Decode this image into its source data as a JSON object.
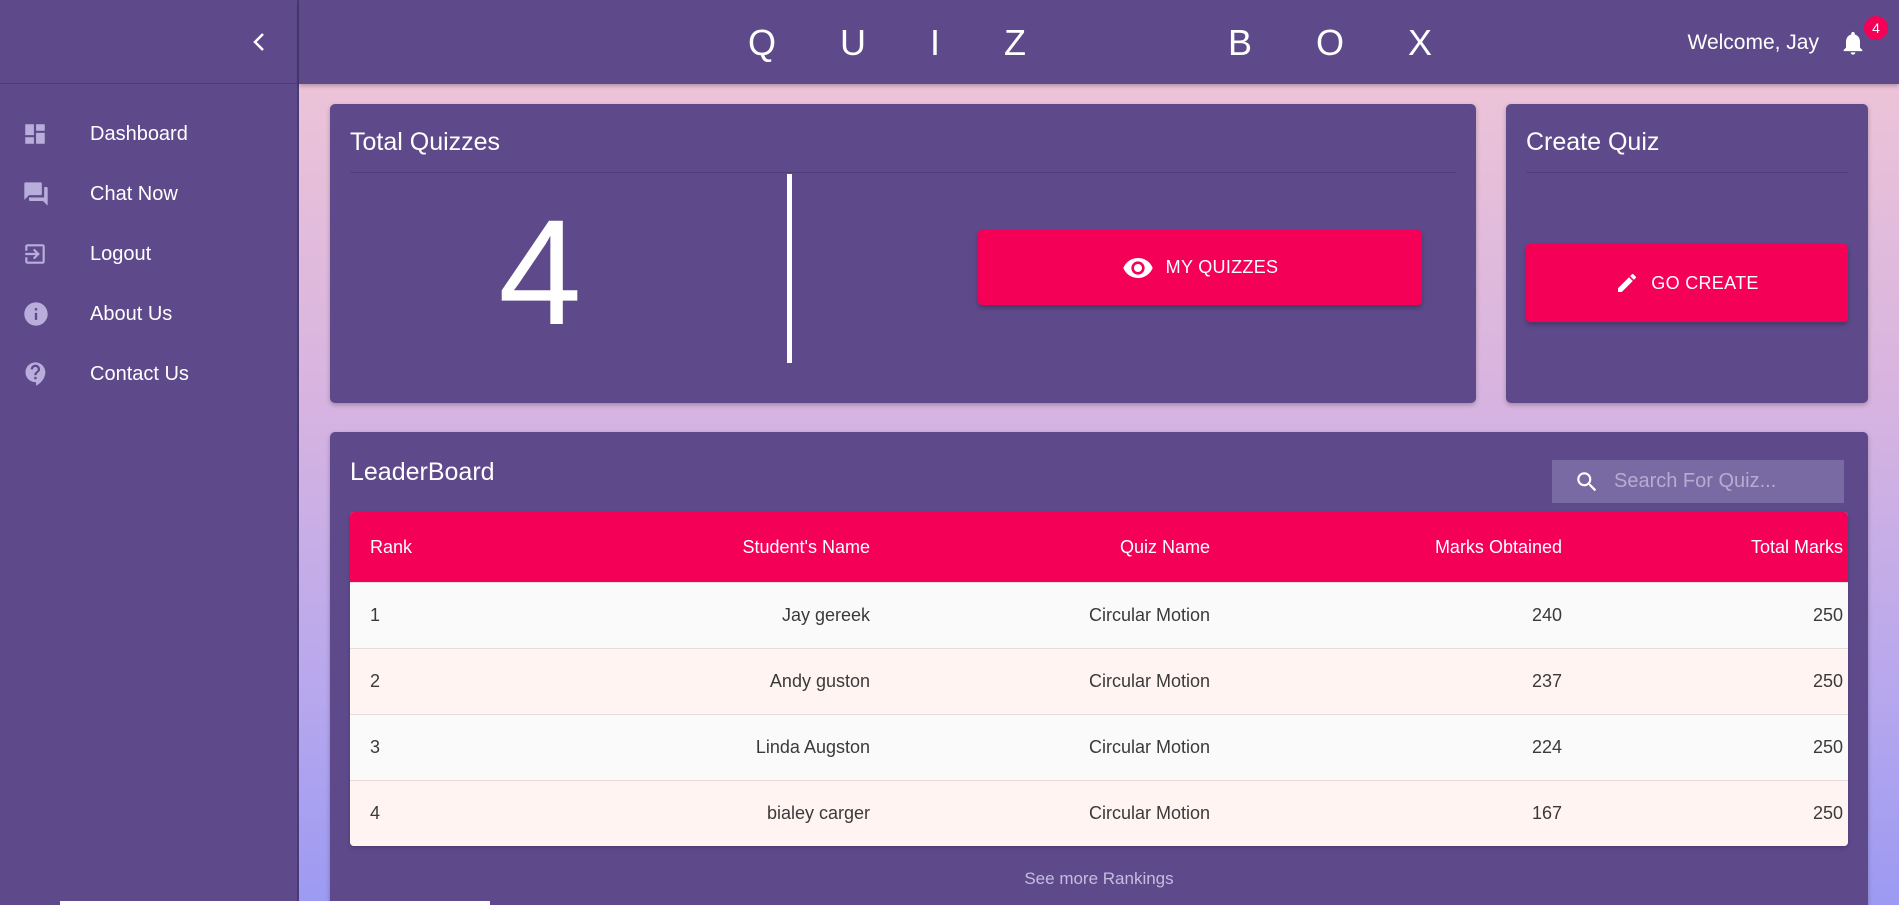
{
  "colors": {
    "primary": "#5e4a8b",
    "accent": "#f50057"
  },
  "sidebar": {
    "collapse_icon": "chevron-left-icon",
    "items": [
      {
        "label": "Dashboard",
        "icon": "dashboard-icon"
      },
      {
        "label": "Chat Now",
        "icon": "chat-icon"
      },
      {
        "label": "Logout",
        "icon": "logout-icon"
      },
      {
        "label": "About Us",
        "icon": "info-icon"
      },
      {
        "label": "Contact Us",
        "icon": "help-icon"
      }
    ]
  },
  "header": {
    "brand": "Q U I Z    B O X",
    "welcome": "Welcome, Jay",
    "notification_count": "4",
    "notification_icon": "bell-icon"
  },
  "total_quizzes": {
    "title": "Total Quizzes",
    "count": "4",
    "button_label": "MY QUIZZES",
    "button_icon": "eye-icon"
  },
  "create_quiz": {
    "title": "Create Quiz",
    "button_label": "GO CREATE",
    "button_icon": "pencil-icon"
  },
  "leaderboard": {
    "title": "LeaderBoard",
    "search_placeholder": "Search For Quiz...",
    "columns": [
      "Rank",
      "Student's Name",
      "Quiz Name",
      "Marks Obtained",
      "Total Marks"
    ],
    "rows": [
      {
        "rank": "1",
        "student": "Jay gereek",
        "quiz": "Circular Motion",
        "marks": "240",
        "total": "250"
      },
      {
        "rank": "2",
        "student": "Andy guston",
        "quiz": "Circular Motion",
        "marks": "237",
        "total": "250"
      },
      {
        "rank": "3",
        "student": "Linda Augston",
        "quiz": "Circular Motion",
        "marks": "224",
        "total": "250"
      },
      {
        "rank": "4",
        "student": "bialey carger",
        "quiz": "Circular Motion",
        "marks": "167",
        "total": "250"
      }
    ],
    "see_more": "See more Rankings"
  }
}
